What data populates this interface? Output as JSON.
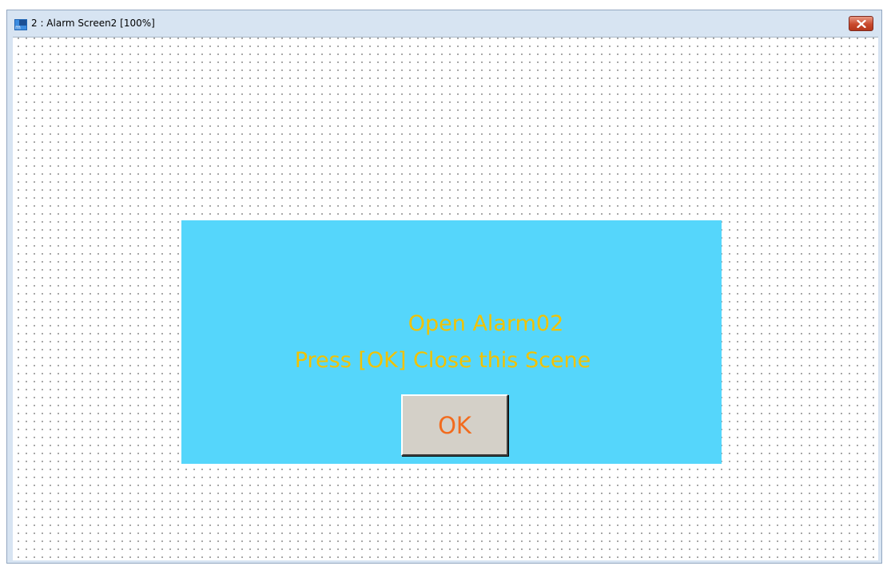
{
  "window": {
    "title": "2 : Alarm Screen2 [100%]",
    "app_icon": "hmi-screen-icon",
    "close_icon": "close-icon"
  },
  "alarm": {
    "line1": "Open Alarm02",
    "line2": "Press [OK] Close this Scene",
    "ok_label": "OK"
  },
  "colors": {
    "panel_bg": "#55d6fb",
    "message_text": "#f2c200",
    "ok_text": "#f26b1d",
    "ok_button_bg": "#d4d0c8",
    "close_button": "#c94a2d"
  }
}
